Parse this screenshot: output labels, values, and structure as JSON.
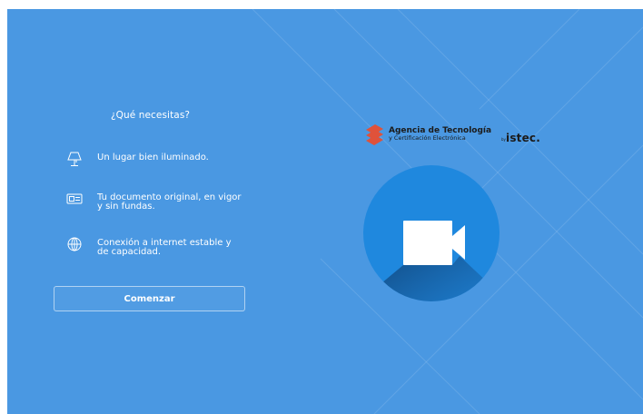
{
  "heading": "¿Qué necesitas?",
  "requirements": [
    {
      "icon": "lamp-icon",
      "text": "Un lugar bien iluminado."
    },
    {
      "icon": "id-card-icon",
      "text": "Tu documento original, en vigor\ny sin fundas."
    },
    {
      "icon": "globe-icon",
      "text": "Conexión a internet estable y\nde capacidad."
    }
  ],
  "start_button": "Comenzar",
  "logo": {
    "line1": "Agencia de Tecnología",
    "line2": "y Certificación Electrónica",
    "by": "by",
    "brand": "istec."
  },
  "colors": {
    "background": "#4a98e2",
    "circle": "#1f88de",
    "logo_mark": "#e0523a"
  },
  "camera_icon": "video-camera-icon"
}
